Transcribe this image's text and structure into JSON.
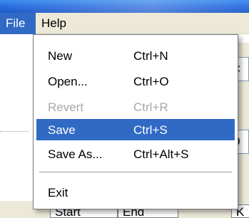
{
  "menubar": {
    "menus": [
      {
        "label": "File"
      },
      {
        "label": "Help"
      }
    ]
  },
  "file_menu": {
    "items": [
      {
        "label": "New",
        "shortcut": "Ctrl+N",
        "state": "normal"
      },
      {
        "label": "Open...",
        "shortcut": "Ctrl+O",
        "state": "normal"
      },
      {
        "label": "Revert",
        "shortcut": "Ctrl+R",
        "state": "disabled"
      },
      {
        "label": "Save",
        "shortcut": "Ctrl+S",
        "state": "selected"
      },
      {
        "label": "Save As...",
        "shortcut": "Ctrl+Alt+S",
        "state": "normal"
      }
    ],
    "exit_label": "Exit"
  },
  "background": {
    "field_1_text": "<",
    "field_2_text": "0",
    "bottom_tabs": [
      "Start",
      "End",
      "K"
    ]
  },
  "colors": {
    "highlight": "#316ac5",
    "menu_bg": "#ece9d8",
    "disabled_text": "#a7a7a7"
  }
}
